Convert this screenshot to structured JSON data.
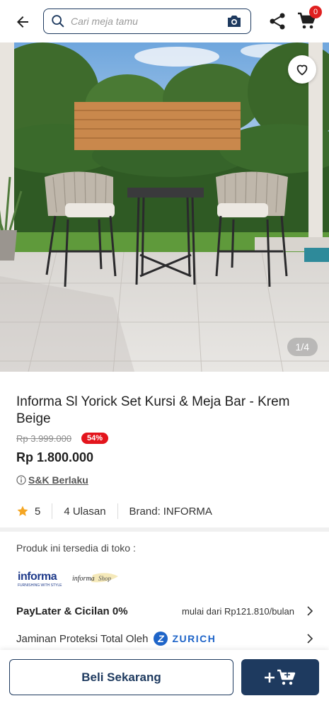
{
  "header": {
    "search_placeholder": "Cari meja tamu",
    "cart_count": "0"
  },
  "gallery": {
    "counter": "1/4"
  },
  "product": {
    "title": "Informa Sl Yorick Set Kursi & Meja Bar - Krem Beige",
    "old_price": "Rp 3.999.000",
    "discount": "54%",
    "price": "Rp 1.800.000",
    "tnc_label": "S&K Berlaku",
    "rating": "5",
    "reviews": "4 Ulasan",
    "brand_label": "Brand:",
    "brand_value": "INFORMA"
  },
  "availability": {
    "label": "Produk ini tersedia di toko :",
    "stores": [
      "informa",
      "informa Shop"
    ]
  },
  "paylater": {
    "label": "PayLater & Cicilan 0%",
    "value": "mulai dari Rp121.810/bulan"
  },
  "protection": {
    "label": "Jaminan Proteksi Total Oleh",
    "brand": "ZURICH"
  },
  "bottom_bar": {
    "buy_now": "Beli Sekarang",
    "add_to_cart_icon": "plus-cart-icon"
  },
  "colors": {
    "primary": "#1e3a5f",
    "discount_red": "#e3141c",
    "zurich_blue": "#1e64c8",
    "star": "#f5a623"
  }
}
